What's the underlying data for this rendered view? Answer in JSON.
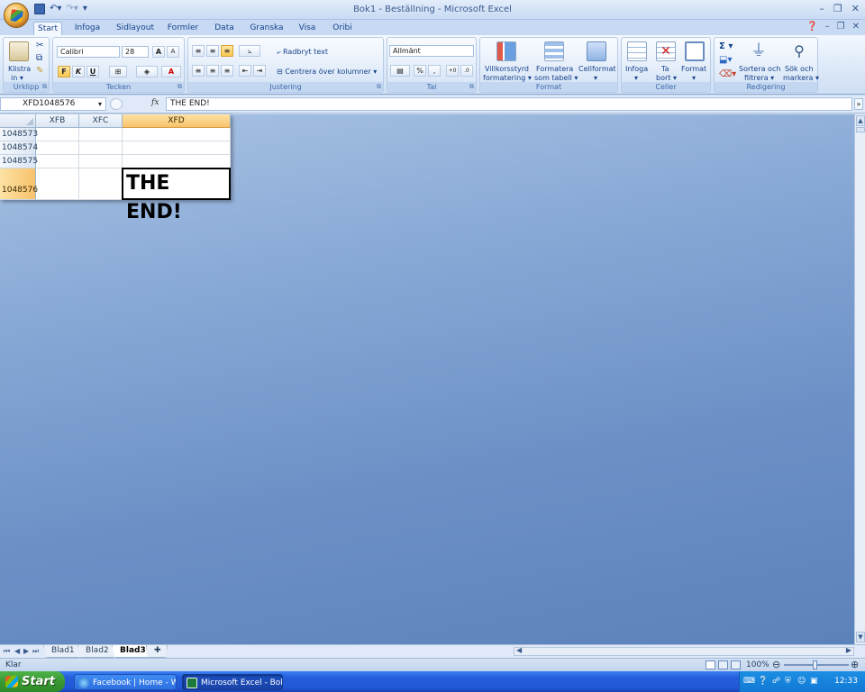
{
  "window": {
    "title": "Bok1 - Beställning - Microsoft Excel"
  },
  "qat": {
    "save_icon": "save-icon",
    "undo_icon": "undo-icon",
    "redo_icon": "redo-icon"
  },
  "tabs": [
    "Start",
    "Infoga",
    "Sidlayout",
    "Formler",
    "Data",
    "Granska",
    "Visa",
    "Oribi"
  ],
  "active_tab": "Start",
  "ribbon": {
    "urklipp": {
      "label": "Urklipp",
      "paste": "Klistra",
      "paste2": "in ▾"
    },
    "tecken": {
      "label": "Tecken",
      "font": "Calibri",
      "size": "28",
      "bold": "F",
      "italic": "K",
      "underline": "U"
    },
    "justering": {
      "label": "Justering",
      "wrap": "Radbryt text",
      "merge": "Centrera över kolumner ▾"
    },
    "tal": {
      "label": "Tal",
      "format": "Allmänt",
      "percent": "%",
      "comma": ","
    },
    "format": {
      "label": "Format",
      "cond": "Villkorsstyrd",
      "cond2": "formatering ▾",
      "table": "Formatera",
      "table2": "som tabell ▾",
      "cell": "Cellformat",
      "cell2": "▾"
    },
    "celler": {
      "label": "Celler",
      "insert": "Infoga",
      "insert2": "▾",
      "delete": "Ta",
      "delete2": "bort ▾",
      "format": "Format",
      "format2": "▾"
    },
    "redigering": {
      "label": "Redigering",
      "sum": "Σ ▾",
      "sort": "Sortera och",
      "sort2": "filtrera ▾",
      "find": "Sök och",
      "find2": "markera ▾"
    }
  },
  "formula": {
    "namebox": "XFD1048576",
    "fx": "fx",
    "value": "THE END!"
  },
  "grid": {
    "columns": [
      "XFB",
      "XFC",
      "XFD"
    ],
    "selected_column": "XFD",
    "rows": [
      "1048573",
      "1048574",
      "1048575",
      "1048576"
    ],
    "selected_row": "1048576",
    "active_value": "THE END!"
  },
  "sheets": [
    "Blad1",
    "Blad2",
    "Blad3"
  ],
  "active_sheet": "Blad3",
  "status": {
    "text": "Klar",
    "zoom": "100%"
  },
  "taskbar": {
    "start": "Start",
    "tasks": [
      "Facebook | Home - W...",
      "Microsoft Excel - Bok..."
    ],
    "clock": "12:33"
  }
}
